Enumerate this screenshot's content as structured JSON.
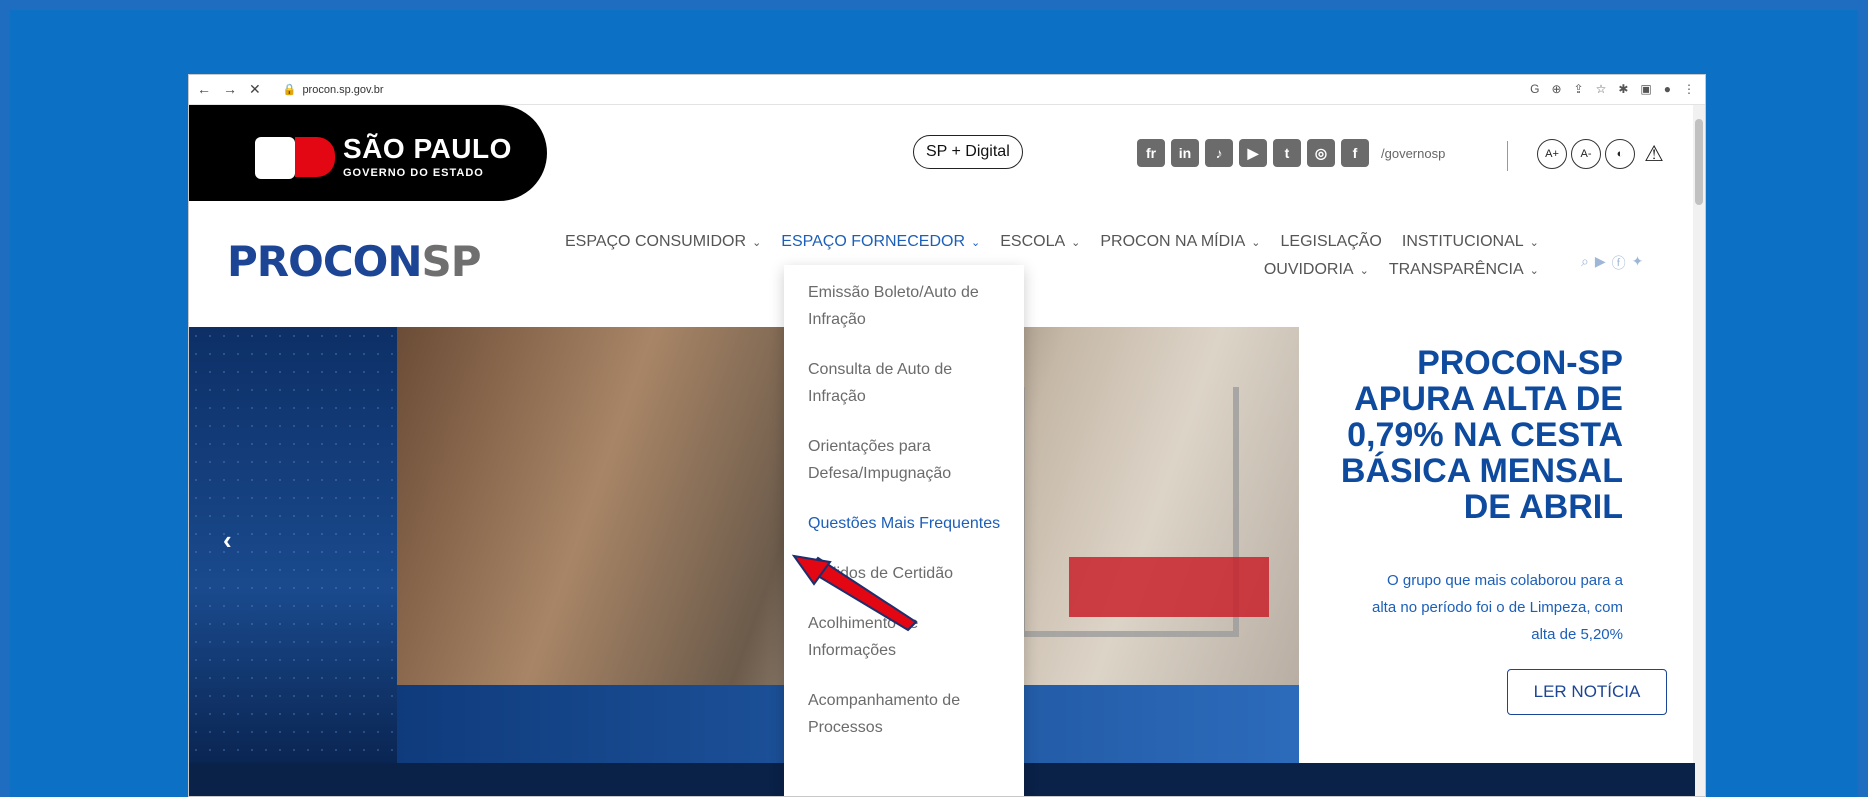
{
  "browser": {
    "url": "procon.sp.gov.br",
    "nav_icons": [
      "back-icon",
      "forward-icon",
      "close-icon"
    ]
  },
  "header": {
    "gov_title": "SÃO PAULO",
    "gov_subtitle": "GOVERNO DO ESTADO",
    "sp_digital": "SP + Digital",
    "social_handle": "/governosp",
    "socials": [
      "fr",
      "in",
      "♪",
      "▶",
      "t",
      "◎",
      "f"
    ],
    "accessibility": [
      "A+",
      "A-",
      "◐",
      "⚠"
    ]
  },
  "brand": {
    "procon": "PROCON",
    "sp": "SP"
  },
  "menu": {
    "row1": [
      "ESPAÇO CONSUMIDOR",
      "ESPAÇO FORNECEDOR",
      "ESCOLA",
      "PROCON NA MÍDIA",
      "LEGISLAÇÃO",
      "INSTITUCIONAL"
    ],
    "row2": [
      "OUVIDORIA",
      "TRANSPARÊNCIA"
    ],
    "active": "ESPAÇO FORNECEDOR"
  },
  "dropdown": {
    "items": [
      "Emissão Boleto/Auto de Infração",
      "Consulta de Auto de Infração",
      "Orientações para Defesa/Impugnação",
      "Questões Mais Frequentes",
      "Pedidos de Certidão",
      "Acolhimento de Informações",
      "Acompanhamento de Processos"
    ],
    "highlighted_index": 3
  },
  "hero": {
    "headline": "PROCON-SP APURA ALTA DE 0,79% NA CESTA BÁSICA MENSAL DE ABRIL",
    "summary": "O grupo que mais colaborou para a alta no período foi o de Limpeza, com alta de 5,20%",
    "button": "LER NOTÍCIA"
  },
  "colors": {
    "accent": "#1c5fb8",
    "brand": "#1c4595",
    "background": "#0c70c5",
    "pointer": "#e30613"
  }
}
